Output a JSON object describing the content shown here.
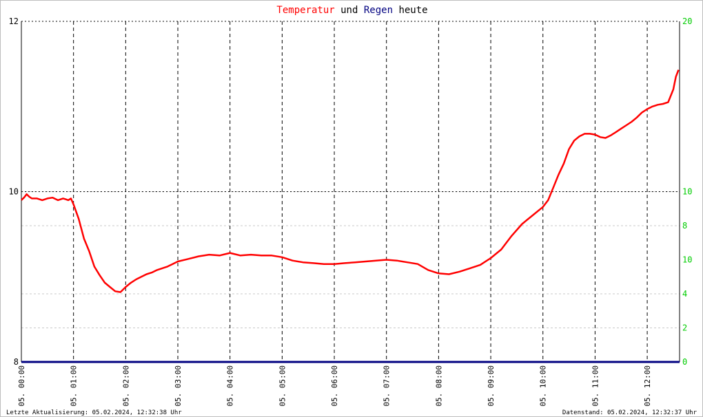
{
  "title": {
    "part1": "Temperatur",
    "part2": " und ",
    "part3": "Regen",
    "part4": " heute",
    "color1": "#ff0000",
    "color2": "#000000",
    "color3": "#000080",
    "color4": "#000000"
  },
  "footer": {
    "left": "Letzte Aktualisierung: 05.02.2024, 12:32:38 Uhr",
    "right": "Datenstand: 05.02.2024, 12:32:37 Uhr"
  },
  "colors": {
    "temperature": "#ff0000",
    "rain": "#000080",
    "right_axis_labels": "#00cc00",
    "left_axis_labels": "#000000",
    "major_grid": "#000000",
    "minor_grid": "#c8c8c8"
  },
  "chart_data": {
    "type": "line",
    "x_tick_labels": [
      "05. 00:00",
      "05. 01:00",
      "05. 02:00",
      "05. 03:00",
      "05. 04:00",
      "05. 05:00",
      "05. 06:00",
      "05. 07:00",
      "05. 08:00",
      "05. 09:00",
      "05. 10:00",
      "05. 11:00",
      "05. 12:00"
    ],
    "x_unit": "hours",
    "xlim": [
      0,
      12.62
    ],
    "y_left": {
      "ylim": [
        8,
        12
      ],
      "ticks": [
        8,
        10,
        12
      ]
    },
    "y_right": {
      "ylim": [
        0,
        20
      ],
      "ticks": [
        0,
        2,
        4,
        6,
        8,
        10,
        20
      ],
      "tick_labels": [
        "0",
        "2",
        "4",
        "10",
        "8",
        "10",
        "20"
      ]
    },
    "grid": true,
    "series": [
      {
        "name": "Temperatur",
        "axis": "left",
        "x": [
          0.0,
          0.05,
          0.1,
          0.15,
          0.2,
          0.3,
          0.4,
          0.5,
          0.6,
          0.7,
          0.8,
          0.85,
          0.9,
          0.95,
          1.0,
          1.1,
          1.2,
          1.3,
          1.4,
          1.5,
          1.6,
          1.7,
          1.8,
          1.9,
          2.0,
          2.1,
          2.2,
          2.3,
          2.4,
          2.5,
          2.6,
          2.7,
          2.8,
          2.9,
          3.0,
          3.2,
          3.4,
          3.6,
          3.8,
          4.0,
          4.2,
          4.4,
          4.6,
          4.8,
          5.0,
          5.2,
          5.4,
          5.6,
          5.8,
          6.0,
          6.2,
          6.4,
          6.6,
          6.8,
          7.0,
          7.2,
          7.4,
          7.6,
          7.8,
          8.0,
          8.2,
          8.4,
          8.6,
          8.8,
          9.0,
          9.2,
          9.4,
          9.6,
          9.8,
          10.0,
          10.1,
          10.2,
          10.3,
          10.4,
          10.5,
          10.6,
          10.7,
          10.8,
          10.9,
          11.0,
          11.1,
          11.2,
          11.3,
          11.4,
          11.5,
          11.6,
          11.7,
          11.8,
          11.9,
          12.0,
          12.1,
          12.2,
          12.3,
          12.4,
          12.5,
          12.55,
          12.6
        ],
        "y": [
          9.9,
          9.93,
          9.97,
          9.94,
          9.92,
          9.92,
          9.9,
          9.92,
          9.93,
          9.9,
          9.92,
          9.91,
          9.9,
          9.92,
          9.85,
          9.68,
          9.45,
          9.3,
          9.12,
          9.02,
          8.93,
          8.88,
          8.83,
          8.82,
          8.88,
          8.93,
          8.97,
          9.0,
          9.03,
          9.05,
          9.08,
          9.1,
          9.12,
          9.15,
          9.18,
          9.21,
          9.24,
          9.26,
          9.25,
          9.28,
          9.25,
          9.26,
          9.25,
          9.25,
          9.23,
          9.19,
          9.17,
          9.16,
          9.15,
          9.15,
          9.16,
          9.17,
          9.18,
          9.19,
          9.2,
          9.19,
          9.17,
          9.15,
          9.08,
          9.04,
          9.03,
          9.06,
          9.1,
          9.14,
          9.22,
          9.32,
          9.48,
          9.62,
          9.72,
          9.82,
          9.9,
          10.05,
          10.2,
          10.33,
          10.5,
          10.6,
          10.65,
          10.68,
          10.68,
          10.67,
          10.64,
          10.63,
          10.66,
          10.7,
          10.74,
          10.78,
          10.82,
          10.87,
          10.93,
          10.97,
          11.0,
          11.02,
          11.03,
          11.05,
          11.2,
          11.35,
          11.43
        ]
      },
      {
        "name": "Regen",
        "axis": "right",
        "x": [
          0.0,
          12.62
        ],
        "y": [
          0,
          0
        ]
      }
    ]
  }
}
